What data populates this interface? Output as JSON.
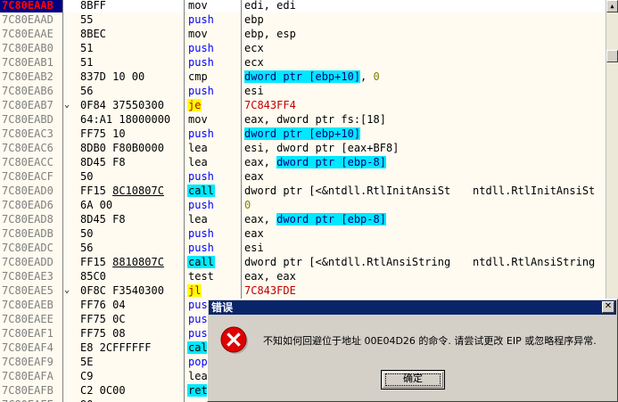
{
  "rows": [
    {
      "addr": "7C80EAAB",
      "arrow": "",
      "hex": "8BFF",
      "mn": "mov",
      "mnc": "",
      "ops": [
        {
          "t": "edi, edi"
        }
      ],
      "sel": true
    },
    {
      "addr": "7C80EAAD",
      "arrow": "",
      "hex": "55",
      "mn": "push",
      "mnc": "blue",
      "ops": [
        {
          "t": "ebp"
        }
      ]
    },
    {
      "addr": "7C80EAAE",
      "arrow": "",
      "hex": "8BEC",
      "mn": "mov",
      "mnc": "",
      "ops": [
        {
          "t": "ebp, esp"
        }
      ]
    },
    {
      "addr": "7C80EAB0",
      "arrow": "",
      "hex": "51",
      "mn": "push",
      "mnc": "blue",
      "ops": [
        {
          "t": "ecx"
        }
      ]
    },
    {
      "addr": "7C80EAB1",
      "arrow": "",
      "hex": "51",
      "mn": "push",
      "mnc": "blue",
      "ops": [
        {
          "t": "ecx"
        }
      ]
    },
    {
      "addr": "7C80EAB2",
      "arrow": "",
      "hex": "837D 10 00",
      "mn": "cmp",
      "mnc": "",
      "ops": [
        {
          "t": "dword ptr [ebp+10]",
          "c": "hl-cyan navy"
        },
        {
          "t": ", "
        },
        {
          "t": "0",
          "c": "olive"
        }
      ]
    },
    {
      "addr": "7C80EAB6",
      "arrow": "",
      "hex": "56",
      "mn": "push",
      "mnc": "blue",
      "ops": [
        {
          "t": "esi"
        }
      ]
    },
    {
      "addr": "7C80EAB7",
      "arrow": "⌄",
      "hex": "0F84 37550300",
      "mn": "je",
      "mnc": "hl-yel",
      "ops": [
        {
          "t": "7C843FF4",
          "c": "red"
        }
      ]
    },
    {
      "addr": "7C80EABD",
      "arrow": "",
      "hex": "64:A1 18000000",
      "mn": "mov",
      "mnc": "",
      "ops": [
        {
          "t": "eax, dword ptr fs:[18]"
        }
      ]
    },
    {
      "addr": "7C80EAC3",
      "arrow": "",
      "hex": "FF75 10",
      "mn": "push",
      "mnc": "blue",
      "ops": [
        {
          "t": "dword ptr [ebp+10]",
          "c": "hl-cyan navy"
        }
      ]
    },
    {
      "addr": "7C80EAC6",
      "arrow": "",
      "hex": "8DB0 F80B0000",
      "mn": "lea",
      "mnc": "",
      "ops": [
        {
          "t": "esi, dword ptr [eax+BF8]"
        }
      ]
    },
    {
      "addr": "7C80EACC",
      "arrow": "",
      "hex": "8D45 F8",
      "mn": "lea",
      "mnc": "",
      "ops": [
        {
          "t": "eax, "
        },
        {
          "t": "dword ptr [ebp-8]",
          "c": "hl-cyan navy"
        }
      ]
    },
    {
      "addr": "7C80EACF",
      "arrow": "",
      "hex": "50",
      "mn": "push",
      "mnc": "blue",
      "ops": [
        {
          "t": "eax"
        }
      ]
    },
    {
      "addr": "7C80EAD0",
      "arrow": "",
      "hex": "FF15 ",
      "hexu": "8C10807C",
      "mn": "call",
      "mnc": "hl-cyan",
      "ops": [
        {
          "t": "dword ptr [<&ntdll.RtlInitAnsiSt"
        },
        {
          "t": "ntdll.RtlInitAnsiSt"
        }
      ]
    },
    {
      "addr": "7C80EAD6",
      "arrow": "",
      "hex": "6A 00",
      "mn": "push",
      "mnc": "blue",
      "ops": [
        {
          "t": "0",
          "c": "olive"
        }
      ]
    },
    {
      "addr": "7C80EAD8",
      "arrow": "",
      "hex": "8D45 F8",
      "mn": "lea",
      "mnc": "",
      "ops": [
        {
          "t": "eax, "
        },
        {
          "t": "dword ptr [ebp-8]",
          "c": "hl-cyan navy"
        }
      ]
    },
    {
      "addr": "7C80EADB",
      "arrow": "",
      "hex": "50",
      "mn": "push",
      "mnc": "blue",
      "ops": [
        {
          "t": "eax"
        }
      ]
    },
    {
      "addr": "7C80EADC",
      "arrow": "",
      "hex": "56",
      "mn": "push",
      "mnc": "blue",
      "ops": [
        {
          "t": "esi"
        }
      ]
    },
    {
      "addr": "7C80EADD",
      "arrow": "",
      "hex": "FF15 ",
      "hexu": "8810807C",
      "mn": "call",
      "mnc": "hl-cyan",
      "ops": [
        {
          "t": "dword ptr [<&ntdll.RtlAnsiString"
        },
        {
          "t": "ntdll.RtlAnsiString"
        }
      ]
    },
    {
      "addr": "7C80EAE3",
      "arrow": "",
      "hex": "85C0",
      "mn": "test",
      "mnc": "",
      "ops": [
        {
          "t": "eax, eax"
        }
      ]
    },
    {
      "addr": "7C80EAE5",
      "arrow": "⌄",
      "hex": "0F8C F3540300",
      "mn": "jl",
      "mnc": "hl-yel",
      "ops": [
        {
          "t": "7C843FDE",
          "c": "red"
        }
      ]
    },
    {
      "addr": "7C80EAEB",
      "arrow": "",
      "hex": "FF76 04",
      "mn": "push",
      "mnc": "blue",
      "ops": []
    },
    {
      "addr": "7C80EAEE",
      "arrow": "",
      "hex": "FF75 0C",
      "mn": "push",
      "mnc": "blue",
      "ops": []
    },
    {
      "addr": "7C80EAF1",
      "arrow": "",
      "hex": "FF75 08",
      "mn": "push",
      "mnc": "blue",
      "ops": []
    },
    {
      "addr": "7C80EAF4",
      "arrow": "",
      "hex": "E8 2CFFFFFF",
      "mn": "call",
      "mnc": "hl-cyan",
      "ops": []
    },
    {
      "addr": "7C80EAF9",
      "arrow": "",
      "hex": "5E",
      "mn": "pop",
      "mnc": "blue",
      "ops": []
    },
    {
      "addr": "7C80EAFA",
      "arrow": "",
      "hex": "C9",
      "mn": "leave",
      "mnc": "",
      "ops": []
    },
    {
      "addr": "7C80EAFB",
      "arrow": "",
      "hex": "C2 0C00",
      "mn": "retn",
      "mnc": "hl-cyan",
      "ops": []
    },
    {
      "addr": "7C80EAFE",
      "arrow": "",
      "hex": "90",
      "mn": "nop",
      "mnc": "",
      "ops": []
    }
  ],
  "dialog": {
    "title": "错误",
    "message": "不知如何回避位于地址 00E04D26 的命令. 请尝试更改 EIP 或忽略程序异常.",
    "ok_label": "确定",
    "close_glyph": "✕"
  },
  "scrollbar": {
    "up_glyph": "▲",
    "down_glyph": "▼"
  }
}
